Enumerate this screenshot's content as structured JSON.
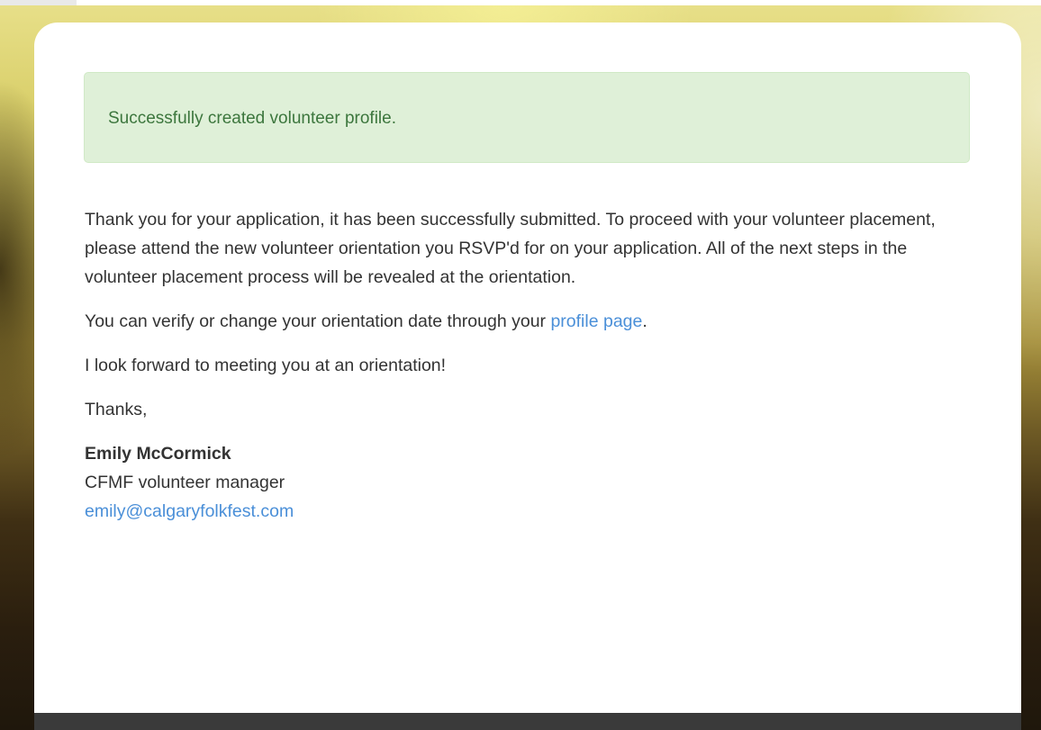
{
  "alert": {
    "message": "Successfully created volunteer profile."
  },
  "body": {
    "paragraph1": "Thank you for your application, it has been successfully submitted. To proceed with your volunteer placement, please attend the new volunteer orientation you RSVP'd for on your application. All of the next steps in the volunteer placement process will be revealed at the orientation.",
    "paragraph2_before": "You can verify or change your orientation date through your ",
    "paragraph2_link": "profile page",
    "paragraph2_after": ".",
    "paragraph3": "I look forward to meeting you at an orientation!",
    "closing": "Thanks,"
  },
  "signature": {
    "name": "Emily McCormick",
    "title": "CFMF volunteer manager",
    "email": "emily@calgaryfolkfest.com"
  },
  "colors": {
    "alert_bg": "#dff0d8",
    "alert_text": "#3c763d",
    "link": "#4a8fd8",
    "body_text": "#333333"
  }
}
